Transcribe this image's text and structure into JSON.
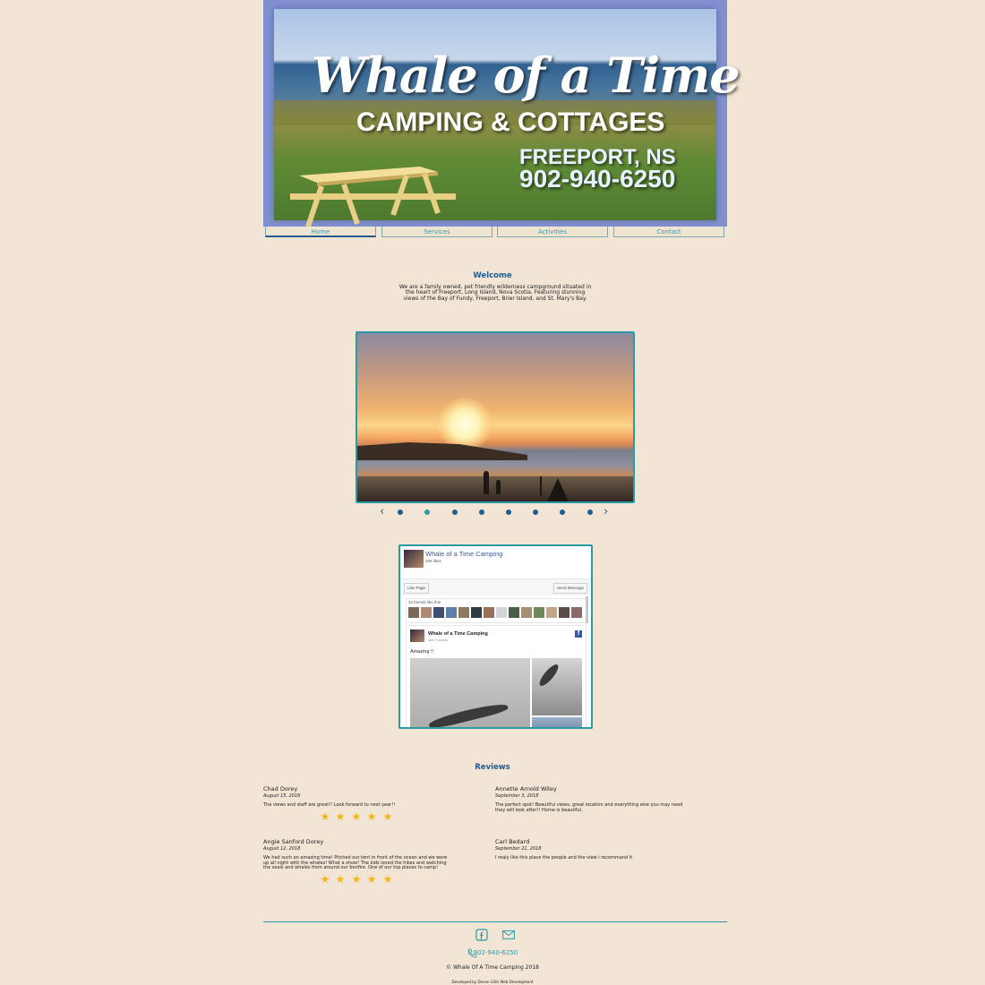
{
  "header": {
    "title": "Whale of a Time",
    "subtitle": "CAMPING & COTTAGES",
    "location": "FREEPORT, NS",
    "phone": "902-940-6250"
  },
  "nav": {
    "items": [
      {
        "label": "Home",
        "active": true
      },
      {
        "label": "Services",
        "active": false
      },
      {
        "label": "Activities",
        "active": false
      },
      {
        "label": "Contact",
        "active": false
      }
    ]
  },
  "welcome": {
    "title": "Welcome",
    "text": "We are a family owned, pet friendly wilderness campground situated in the heart of Freeport, Long Island, Nova Scotia. Featuring stunning views of the Bay of Fundy, Freeport, Brier Island, and St. Mary's Bay."
  },
  "slideshow": {
    "prev_icon": "chevron-left-icon",
    "next_icon": "chevron-right-icon",
    "dot_count": 8,
    "active_index": 1
  },
  "facebook": {
    "page_name": "Whale of a Time Camping",
    "likes": "408 likes",
    "like_button": "Like Page",
    "message_button": "Send Message",
    "friends_text": "34 friends like this",
    "post_author": "Whale of a Time Camping",
    "post_date": "last Tuesday",
    "post_text": "Amazing !!"
  },
  "reviews": {
    "title": "Reviews",
    "items": [
      {
        "name": "Chad Dorey",
        "date": "August 15, 2018",
        "text": "The views and staff are great!! Look forward to next year!!",
        "stars": 5
      },
      {
        "name": "Annette Arnold Wiley",
        "date": "September 3, 2018",
        "text": "The perfect spot! Beautiful views, great location and everything else you may need they will look after!! Home is beautiful.",
        "stars": 0
      },
      {
        "name": "Angie Sanford Dorey",
        "date": "August 12, 2018",
        "text": "We had such an amazing time! Pitched our tent in front of the ocean and we were up all night with the whales! What a show! The kids loved the hikes and watching the seals and whales from around our bonfire. One of our top places to camp!",
        "stars": 5
      },
      {
        "name": "Carl Bedard",
        "date": "September 21, 2018",
        "text": "I realy like this place the people and the view i recommand it",
        "stars": 0
      }
    ]
  },
  "footer": {
    "phone": "1 902-940-6250",
    "copyright": "© Whale Of A Time Camping 2018",
    "developer": "Developed by Devan Gillis Web Development",
    "icons": [
      "facebook-icon",
      "mail-icon",
      "phone-icon"
    ]
  },
  "colors": {
    "background": "#f2e5d5",
    "accent": "#2a9ba6",
    "heading": "#1f5d8f",
    "star": "#f2b81b"
  }
}
